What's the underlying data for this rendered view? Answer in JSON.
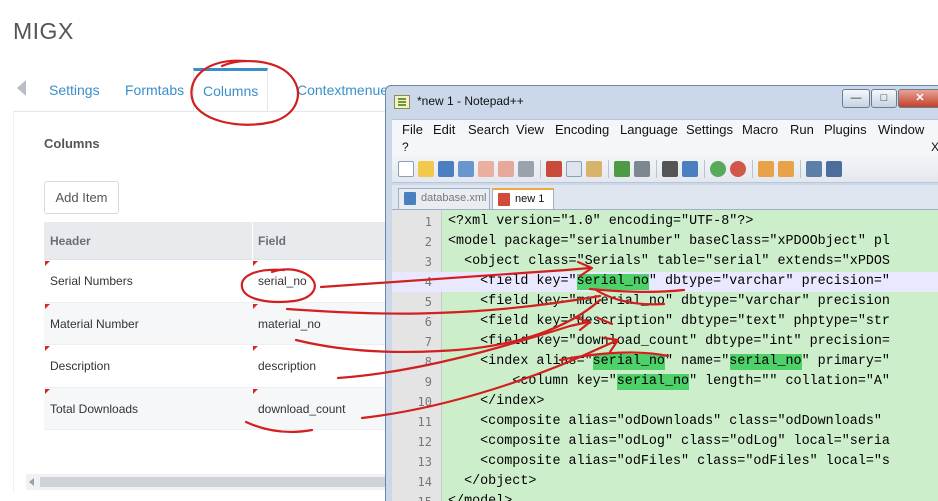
{
  "migx": {
    "title": "MIGX",
    "tabs": [
      "Settings",
      "Formtabs",
      "Columns",
      "Contextmenue"
    ],
    "active_tab": "Columns",
    "section_label": "Columns",
    "add_item_label": "Add Item",
    "grid": {
      "headers": [
        "Header",
        "Field"
      ],
      "rows": [
        {
          "header": "Serial Numbers",
          "field": "serial_no"
        },
        {
          "header": "Material Number",
          "field": "material_no"
        },
        {
          "header": "Description",
          "field": "description"
        },
        {
          "header": "Total Downloads",
          "field": "download_count"
        }
      ]
    }
  },
  "notepad": {
    "title": "*new  1 - Notepad++",
    "window_buttons": [
      "—",
      "□",
      "✕"
    ],
    "menu": [
      "File",
      "Edit",
      "Search",
      "View",
      "Encoding",
      "Language",
      "Settings",
      "Macro",
      "Run",
      "Plugins",
      "Window"
    ],
    "menu_help": "?",
    "menu_close": "X",
    "file_tabs": [
      {
        "label": "database.xml",
        "active": false
      },
      {
        "label": "new  1",
        "active": true
      }
    ],
    "current_line": 4,
    "lines": [
      {
        "n": "1",
        "text": "<?xml version=\"1.0\" encoding=\"UTF-8\"?>"
      },
      {
        "n": "2",
        "text": "<model package=\"serialnumber\" baseClass=\"xPDOObject\" pl"
      },
      {
        "n": "3",
        "text": "  <object class=\"Serials\" table=\"serial\" extends=\"xPDOS"
      },
      {
        "n": "4",
        "text": "    <field key=\"serial_no\" dbtype=\"varchar\" precision=\""
      },
      {
        "n": "5",
        "text": "    <field key=\"material_no\" dbtype=\"varchar\" precision"
      },
      {
        "n": "6",
        "text": "    <field key=\"description\" dbtype=\"text\" phptype=\"str"
      },
      {
        "n": "7",
        "text": "    <field key=\"download_count\" dbtype=\"int\" precision="
      },
      {
        "n": "8",
        "text": "    <index alias=\"serial_no\" name=\"serial_no\" primary=\""
      },
      {
        "n": "9",
        "text": "        <column key=\"serial_no\" length=\"\" collation=\"A\""
      },
      {
        "n": "10",
        "text": "    </index>"
      },
      {
        "n": "11",
        "text": "    <composite alias=\"odDownloads\" class=\"odDownloads\" "
      },
      {
        "n": "12",
        "text": "    <composite alias=\"odLog\" class=\"odLog\" local=\"seria"
      },
      {
        "n": "13",
        "text": "    <composite alias=\"odFiles\" class=\"odFiles\" local=\"s"
      },
      {
        "n": "14",
        "text": "  </object>"
      },
      {
        "n": "15",
        "text": "</model>"
      }
    ],
    "highlight_token": "serial_no"
  },
  "colors": {
    "accent": "#3a8fc9",
    "annotation": "#d21f1f",
    "editor_bg": "#cdeecb",
    "highlight": "#4fd16a"
  },
  "icons": [
    "new-file-icon",
    "open-icon",
    "save-icon",
    "save-all-icon",
    "close-icon",
    "close-all-icon",
    "print-icon",
    "cut-icon",
    "copy-icon",
    "paste-icon",
    "undo-icon",
    "redo-icon",
    "find-icon",
    "replace-icon",
    "zoom-in-icon",
    "zoom-out-icon",
    "sync-v-icon",
    "sync-h-icon",
    "wrap-icon",
    "show-symbols-icon"
  ]
}
